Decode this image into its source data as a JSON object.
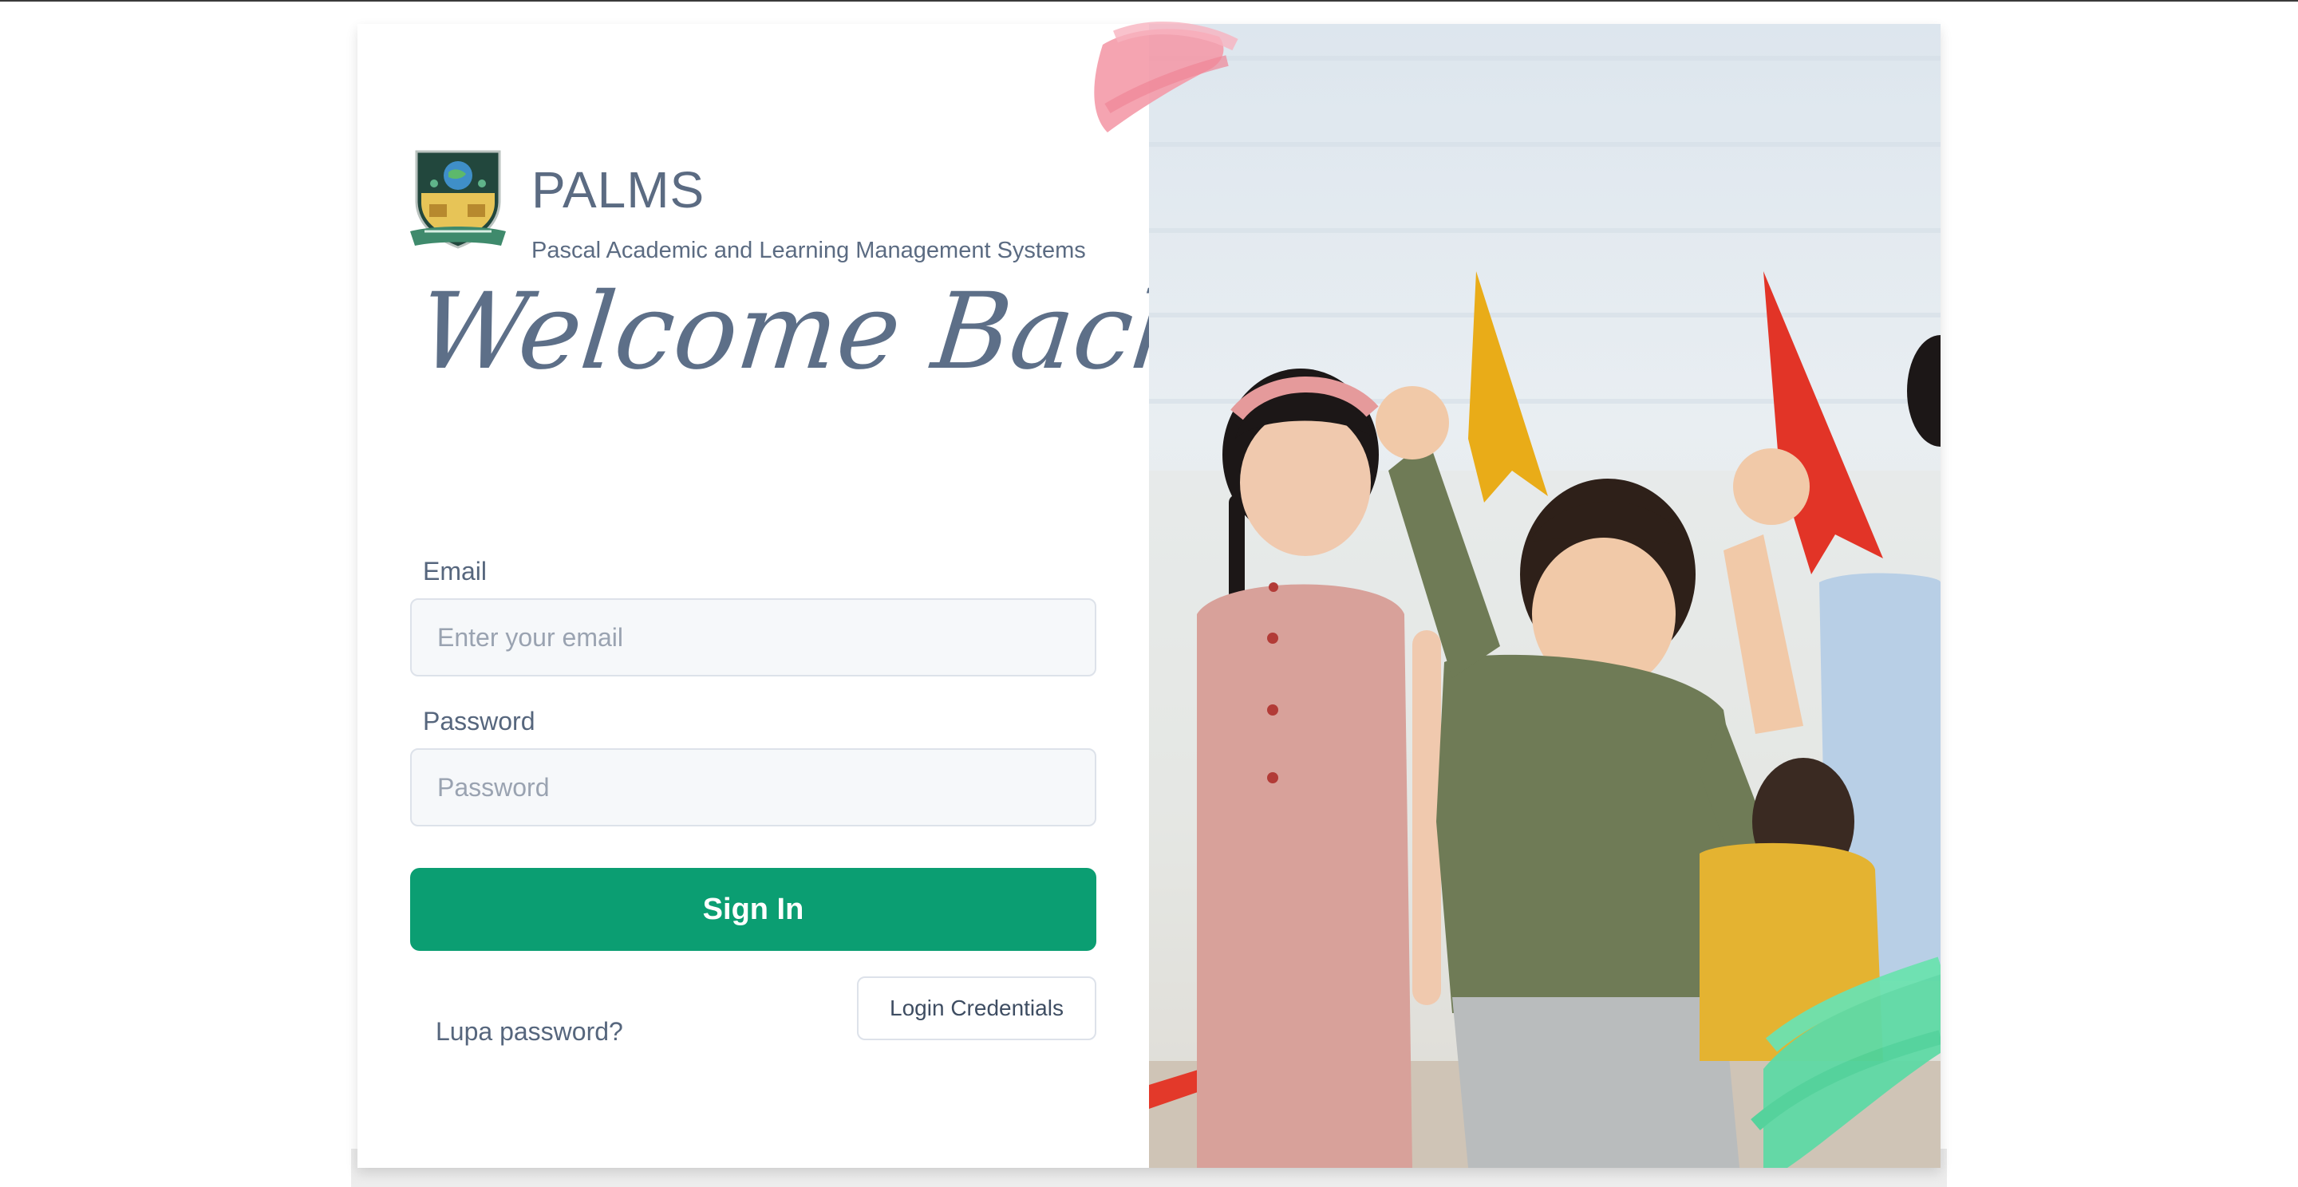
{
  "brand": {
    "title": "PALMS",
    "subtitle": "Pascal Academic and Learning Management Systems",
    "logo_icon": "school-crest-icon"
  },
  "heading": "Welcome Back",
  "form": {
    "email_label": "Email",
    "email_placeholder": "Enter your email",
    "email_value": "",
    "password_label": "Password",
    "password_placeholder": "Password",
    "password_value": "",
    "submit_label": "Sign In"
  },
  "links": {
    "forgot_password": "Lupa password?",
    "login_credentials": "Login Credentials"
  },
  "colors": {
    "accent": "#0b9e72",
    "text": "#5b6b82",
    "input_bg": "#f6f8fa",
    "pink_brush": "#f49aa9",
    "green_brush": "#5fdaa6"
  }
}
